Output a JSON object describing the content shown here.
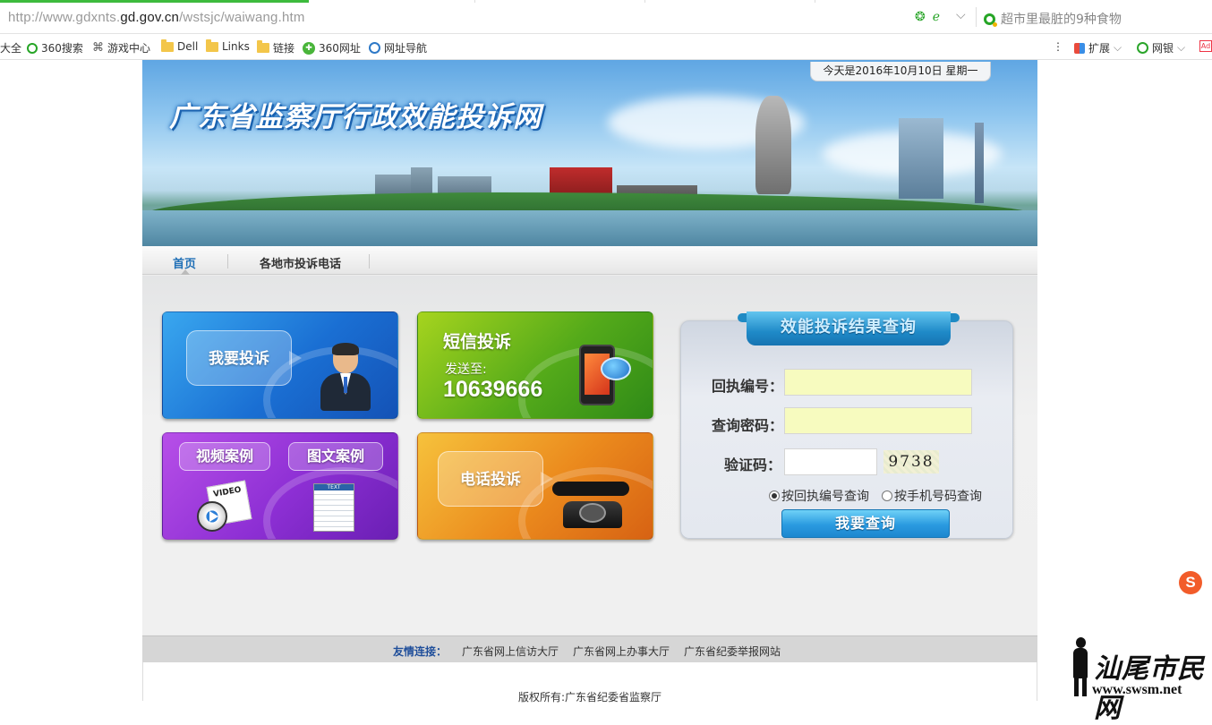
{
  "browser": {
    "url_prefix": "http://www.gdxnts.",
    "url_domain": "gd.gov.cn",
    "url_path": "/wstsjc/waiwang.htm",
    "search_suggestion": "超市里最脏的9种食物",
    "bookmarks": [
      "大全",
      "360搜索",
      "游戏中心",
      "Dell",
      "Links",
      "链接",
      "360网址",
      "网址导航"
    ],
    "right_tools": [
      "扩展",
      "网银"
    ],
    "colors": {
      "progress": "#3dbb3d"
    }
  },
  "site": {
    "title": "广东省监察厅行政效能投诉网",
    "date": "今天是2016年10月10日 星期一"
  },
  "nav": {
    "items": [
      "首页",
      "各地市投诉电话"
    ],
    "active": "首页"
  },
  "tiles": {
    "complain": {
      "label": "我要投诉"
    },
    "sms": {
      "title": "短信投诉",
      "sub": "发送至:",
      "number": "10639666"
    },
    "video_case": "视频案例",
    "video_tag": "VIDEO",
    "image_case": "图文案例",
    "text_tag": "TEXT",
    "phone": "电话投诉"
  },
  "query": {
    "title": "效能投诉结果查询",
    "receipt_label": "回执编号：",
    "password_label": "查询密码：",
    "captcha_label": "验证码：",
    "receipt_value": "",
    "password_value": "",
    "captcha_value": "",
    "captcha_text": "9738",
    "radio_receipt": "按回执编号查询",
    "radio_phone": "按手机号码查询",
    "submit": "我要查询",
    "colors": {
      "input_bg": "#f7fbbf",
      "button": "#2a9ae0"
    }
  },
  "links": {
    "label": "友情连接：",
    "items": [
      "广东省网上信访大厅",
      "广东省网上办事大厅",
      "广东省纪委举报网站"
    ]
  },
  "footer": {
    "copyright": "版权所有:广东省纪委省监察厅"
  },
  "watermark": {
    "text": "汕尾市民网",
    "url": "www.swsm.net"
  }
}
